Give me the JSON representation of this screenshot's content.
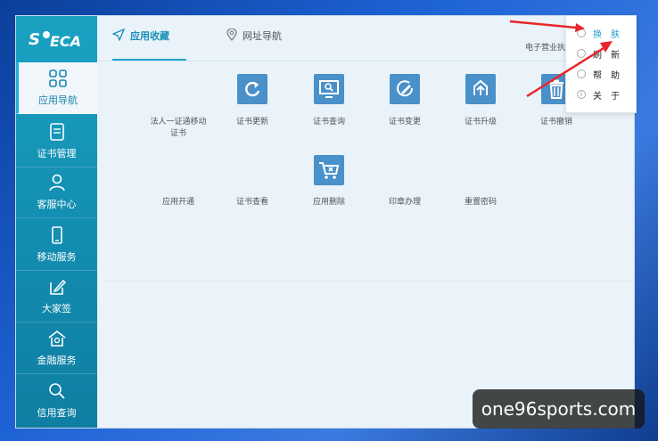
{
  "sidebar": {
    "items": [
      {
        "label": "应用导航",
        "icon": "apps-grid-icon"
      },
      {
        "label": "证书管理",
        "icon": "document-icon"
      },
      {
        "label": "客服中心",
        "icon": "user-icon"
      },
      {
        "label": "移动服务",
        "icon": "mobile-icon"
      },
      {
        "label": "大家签",
        "icon": "edit-icon"
      },
      {
        "label": "金融服务",
        "icon": "home-bank-icon"
      },
      {
        "label": "信用查询",
        "icon": "search-icon"
      }
    ]
  },
  "tabs": [
    {
      "label": "应用收藏",
      "icon": "send-icon"
    },
    {
      "label": "网址导航",
      "icon": "location-pin-icon"
    }
  ],
  "header": {
    "tenant": "电子营业执照登"
  },
  "window_controls": {
    "menu": "☰",
    "minimize": "–",
    "close": "✕"
  },
  "menu": [
    {
      "label": "换肤",
      "icon": "skin-icon"
    },
    {
      "label": "刷新",
      "icon": "refresh-icon"
    },
    {
      "label": "帮助",
      "icon": "help-icon"
    },
    {
      "label": "关于",
      "icon": "info-icon"
    }
  ],
  "apps": [
    {
      "label": "法人一证通移动证书",
      "icon": ""
    },
    {
      "label": "证书更新",
      "icon": "refresh-icon"
    },
    {
      "label": "证书查询",
      "icon": "monitor-search-icon"
    },
    {
      "label": "证书变更",
      "icon": "edit-circle-icon"
    },
    {
      "label": "证书升级",
      "icon": "upgrade-icon"
    },
    {
      "label": "证书撤销",
      "icon": "trash-icon"
    },
    {
      "label": "应用开通",
      "icon": ""
    },
    {
      "label": "证书查看",
      "icon": ""
    },
    {
      "label": "应用删除",
      "icon": "cart-remove-icon"
    },
    {
      "label": "印章办理",
      "icon": ""
    },
    {
      "label": "重置密码",
      "icon": ""
    }
  ],
  "watermark": "one96sports.com",
  "colors": {
    "sidebar": "#138eb1",
    "accent": "#1fa4cc",
    "icon_tile": "#4a90c9",
    "arrow": "#e8262b"
  }
}
